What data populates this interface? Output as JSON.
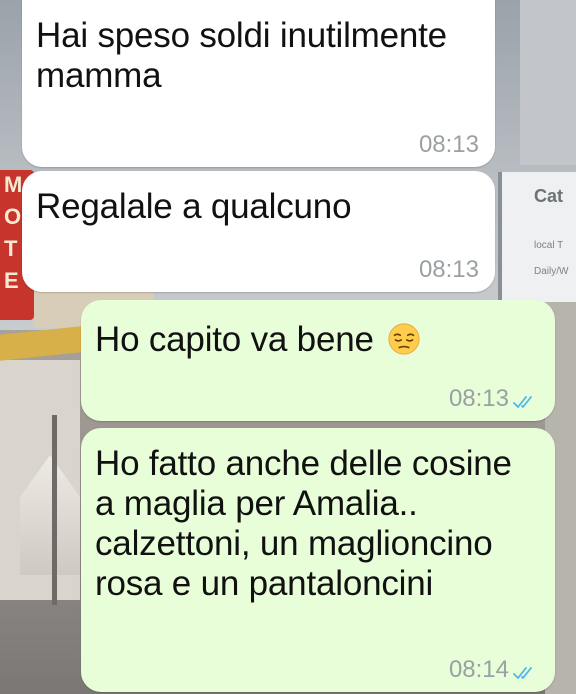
{
  "chat": {
    "messages": [
      {
        "direction": "incoming",
        "text": "Hai speso soldi inutilmente mamma",
        "time": "08:13"
      },
      {
        "direction": "incoming",
        "text": "Regalale a qualcuno",
        "time": "08:13"
      },
      {
        "direction": "outgoing",
        "text": "Ho capito va bene",
        "emoji": "pensive-face-emoji",
        "time": "08:13",
        "status": "read"
      },
      {
        "direction": "outgoing",
        "text": "Ho fatto anche delle cosine a maglia per Amalia.. calzettoni, un maglioncino rosa e un pantaloncini",
        "time": "08:14",
        "status": "read"
      }
    ]
  },
  "colors": {
    "incoming_bubble": "#ffffff",
    "outgoing_bubble": "#e7fed8",
    "time_text": "#9aa0a3",
    "read_ticks": "#4fb6ec"
  },
  "icons": {
    "read_receipt": "double-check-icon"
  },
  "wallpaper": {
    "sign_letters": [
      "M",
      "O",
      "T",
      "E"
    ],
    "billboard_title": "Cat",
    "billboard_lines": [
      "local T",
      "Daily/W"
    ]
  }
}
